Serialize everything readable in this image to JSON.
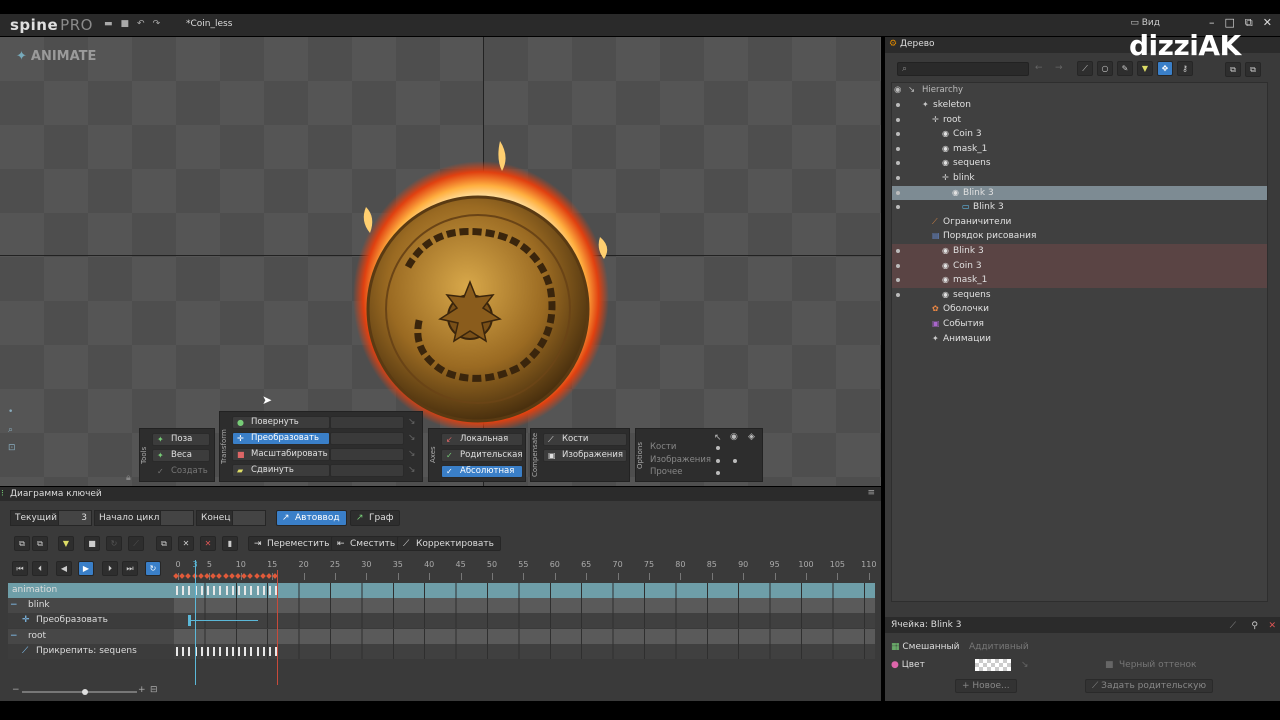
{
  "app": {
    "logo_text": "spine",
    "logo_pro": "PRO",
    "filename": "*Coin_less",
    "view_menu": "Вид"
  },
  "watermark": "dizziAK",
  "viewport": {
    "mode_label": "ANIMATE"
  },
  "tools": {
    "label": "Tools",
    "pose": "Поза",
    "weights": "Веса",
    "create": "Создать"
  },
  "transform": {
    "label": "Transform",
    "rotate": "Повернуть",
    "translate": "Преобразовать",
    "scale": "Масштабировать",
    "shear": "Сдвинуть"
  },
  "axes": {
    "label": "Axes",
    "local": "Локальная",
    "parent": "Родительская",
    "world": "Абсолютная"
  },
  "compensate": {
    "label": "Compensate",
    "bones": "Кости",
    "images": "Изображения"
  },
  "options": {
    "label": "Options",
    "bones": "Кости",
    "images": "Изображения",
    "other": "Прочее"
  },
  "dopesheet": {
    "title": "Диаграмма ключей",
    "current_label": "Текущий",
    "current_value": "3",
    "loop_start_label": "Начало цикла",
    "loop_start_value": "",
    "end_label": "Конец",
    "end_value": "",
    "autokey": "Автоввод",
    "graph": "Граф",
    "move": "Переместить",
    "offset": "Сместить",
    "adjust": "Корректировать",
    "ruler_ticks": [
      "0",
      "5",
      "10",
      "15",
      "20",
      "25",
      "30",
      "35",
      "40",
      "45",
      "50",
      "55",
      "60",
      "65",
      "70",
      "75",
      "80",
      "85",
      "90",
      "95",
      "100",
      "105",
      "110"
    ],
    "ruler_marker": "3",
    "tracks": [
      {
        "name": "animation",
        "kind": "animation"
      },
      {
        "name": "blink",
        "kind": "bone"
      },
      {
        "name": "Преобразовать",
        "kind": "property"
      },
      {
        "name": "root",
        "kind": "bone"
      },
      {
        "name": "Прикрепить: sequens",
        "kind": "attachment"
      }
    ]
  },
  "tree": {
    "tab": "Дерево",
    "search_placeholder": "",
    "hierarchy_label": "Hierarchy",
    "nodes": [
      {
        "label": "skeleton",
        "icon": "skeleton-icon",
        "depth": 0,
        "vis": true
      },
      {
        "label": "root",
        "icon": "bone-icon",
        "depth": 1,
        "vis": true
      },
      {
        "label": "Coin 3",
        "icon": "slot-icon",
        "depth": 2,
        "vis": true
      },
      {
        "label": "mask_1",
        "icon": "slot-icon",
        "depth": 2,
        "vis": true
      },
      {
        "label": "sequens",
        "icon": "slot-icon",
        "depth": 2,
        "vis": true
      },
      {
        "label": "blink",
        "icon": "bone-icon",
        "depth": 2,
        "vis": true
      },
      {
        "label": "Blink 3",
        "icon": "slot-icon",
        "depth": 3,
        "vis": true,
        "state": "sel"
      },
      {
        "label": "Blink 3",
        "icon": "image-icon",
        "depth": 4,
        "vis": true
      },
      {
        "label": "Ограничители",
        "icon": "constraints-icon",
        "depth": 1,
        "vis": false
      },
      {
        "label": "Порядок рисования",
        "icon": "draworder-icon",
        "depth": 1,
        "vis": false
      },
      {
        "label": "Blink 3",
        "icon": "slot-icon",
        "depth": 2,
        "vis": true,
        "state": "hl"
      },
      {
        "label": "Coin 3",
        "icon": "slot-icon",
        "depth": 2,
        "vis": true,
        "state": "hl"
      },
      {
        "label": "mask_1",
        "icon": "slot-icon",
        "depth": 2,
        "vis": true,
        "state": "hl"
      },
      {
        "label": "sequens",
        "icon": "slot-icon",
        "depth": 2,
        "vis": true
      },
      {
        "label": "Оболочки",
        "icon": "skins-icon",
        "depth": 1,
        "vis": false
      },
      {
        "label": "События",
        "icon": "events-icon",
        "depth": 1,
        "vis": false
      },
      {
        "label": "Анимации",
        "icon": "animations-icon",
        "depth": 1,
        "vis": false
      }
    ],
    "cell_title": "Ячейка: Blink 3",
    "blend_label": "Смешанный",
    "blend_value": "Аддитивный",
    "color_label": "Цвет",
    "dark_color": "Черный оттенок",
    "new_button": "Новое...",
    "set_parent": "Задать родительскую"
  },
  "colors": {
    "accent": "#3a7fc8",
    "selected_row": "#7d8b93",
    "highlight_row": "#5a4444",
    "keyframe": "#e05a3a",
    "playhead": "#5bb8d8"
  }
}
